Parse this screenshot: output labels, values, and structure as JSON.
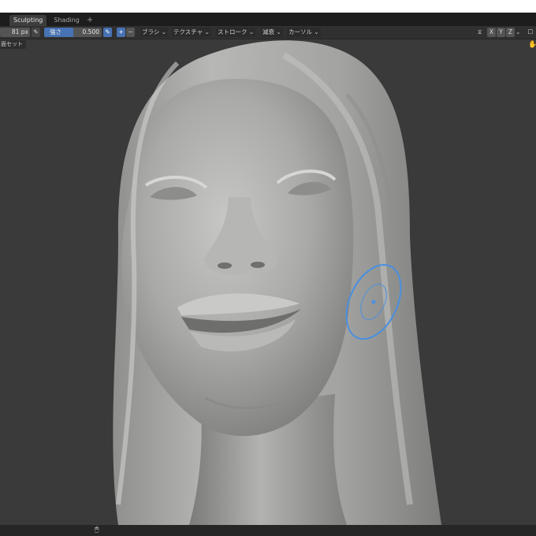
{
  "tabs": [
    {
      "label": "Sculpting",
      "active": true
    },
    {
      "label": "Shading",
      "active": false
    }
  ],
  "tab_add_label": "+",
  "toolbar": {
    "radius_value": "81 px",
    "strength_label": "強さ",
    "strength_value": "0.500",
    "strength_fraction": 0.5,
    "plus_label": "+",
    "minus_label": "−",
    "menus": [
      "ブラシ",
      "テクスチャ",
      "ストローク",
      "減衰",
      "カーソル"
    ],
    "axes": [
      "X",
      "Y",
      "Z"
    ]
  },
  "viewport": {
    "face_sets_label": "面セット",
    "brush_cursor_color": "#4a8fe0",
    "background_color": "#3a3a3a",
    "mesh_color": "#a9aaa8"
  },
  "icons": [
    "pen-icon",
    "pressure-pen-icon",
    "mirror-icon",
    "chevron-down-icon",
    "overlay-icon",
    "navigate-icon",
    "mouse-icon"
  ],
  "colors": {
    "accent": "#4772b3",
    "header": "#303030",
    "tabbar": "#1d1d1d"
  }
}
